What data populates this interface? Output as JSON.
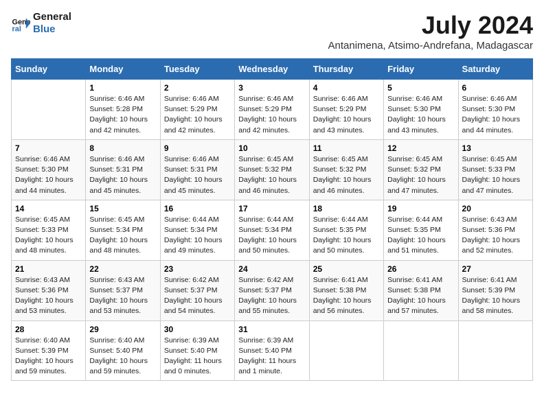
{
  "logo": {
    "line1": "General",
    "line2": "Blue"
  },
  "title": "July 2024",
  "subtitle": "Antanimena, Atsimo-Andrefana, Madagascar",
  "days_of_week": [
    "Sunday",
    "Monday",
    "Tuesday",
    "Wednesday",
    "Thursday",
    "Friday",
    "Saturday"
  ],
  "weeks": [
    [
      {
        "num": "",
        "info": ""
      },
      {
        "num": "1",
        "info": "Sunrise: 6:46 AM\nSunset: 5:28 PM\nDaylight: 10 hours\nand 42 minutes."
      },
      {
        "num": "2",
        "info": "Sunrise: 6:46 AM\nSunset: 5:29 PM\nDaylight: 10 hours\nand 42 minutes."
      },
      {
        "num": "3",
        "info": "Sunrise: 6:46 AM\nSunset: 5:29 PM\nDaylight: 10 hours\nand 42 minutes."
      },
      {
        "num": "4",
        "info": "Sunrise: 6:46 AM\nSunset: 5:29 PM\nDaylight: 10 hours\nand 43 minutes."
      },
      {
        "num": "5",
        "info": "Sunrise: 6:46 AM\nSunset: 5:30 PM\nDaylight: 10 hours\nand 43 minutes."
      },
      {
        "num": "6",
        "info": "Sunrise: 6:46 AM\nSunset: 5:30 PM\nDaylight: 10 hours\nand 44 minutes."
      }
    ],
    [
      {
        "num": "7",
        "info": "Sunrise: 6:46 AM\nSunset: 5:30 PM\nDaylight: 10 hours\nand 44 minutes."
      },
      {
        "num": "8",
        "info": "Sunrise: 6:46 AM\nSunset: 5:31 PM\nDaylight: 10 hours\nand 45 minutes."
      },
      {
        "num": "9",
        "info": "Sunrise: 6:46 AM\nSunset: 5:31 PM\nDaylight: 10 hours\nand 45 minutes."
      },
      {
        "num": "10",
        "info": "Sunrise: 6:45 AM\nSunset: 5:32 PM\nDaylight: 10 hours\nand 46 minutes."
      },
      {
        "num": "11",
        "info": "Sunrise: 6:45 AM\nSunset: 5:32 PM\nDaylight: 10 hours\nand 46 minutes."
      },
      {
        "num": "12",
        "info": "Sunrise: 6:45 AM\nSunset: 5:32 PM\nDaylight: 10 hours\nand 47 minutes."
      },
      {
        "num": "13",
        "info": "Sunrise: 6:45 AM\nSunset: 5:33 PM\nDaylight: 10 hours\nand 47 minutes."
      }
    ],
    [
      {
        "num": "14",
        "info": "Sunrise: 6:45 AM\nSunset: 5:33 PM\nDaylight: 10 hours\nand 48 minutes."
      },
      {
        "num": "15",
        "info": "Sunrise: 6:45 AM\nSunset: 5:34 PM\nDaylight: 10 hours\nand 48 minutes."
      },
      {
        "num": "16",
        "info": "Sunrise: 6:44 AM\nSunset: 5:34 PM\nDaylight: 10 hours\nand 49 minutes."
      },
      {
        "num": "17",
        "info": "Sunrise: 6:44 AM\nSunset: 5:34 PM\nDaylight: 10 hours\nand 50 minutes."
      },
      {
        "num": "18",
        "info": "Sunrise: 6:44 AM\nSunset: 5:35 PM\nDaylight: 10 hours\nand 50 minutes."
      },
      {
        "num": "19",
        "info": "Sunrise: 6:44 AM\nSunset: 5:35 PM\nDaylight: 10 hours\nand 51 minutes."
      },
      {
        "num": "20",
        "info": "Sunrise: 6:43 AM\nSunset: 5:36 PM\nDaylight: 10 hours\nand 52 minutes."
      }
    ],
    [
      {
        "num": "21",
        "info": "Sunrise: 6:43 AM\nSunset: 5:36 PM\nDaylight: 10 hours\nand 53 minutes."
      },
      {
        "num": "22",
        "info": "Sunrise: 6:43 AM\nSunset: 5:37 PM\nDaylight: 10 hours\nand 53 minutes."
      },
      {
        "num": "23",
        "info": "Sunrise: 6:42 AM\nSunset: 5:37 PM\nDaylight: 10 hours\nand 54 minutes."
      },
      {
        "num": "24",
        "info": "Sunrise: 6:42 AM\nSunset: 5:37 PM\nDaylight: 10 hours\nand 55 minutes."
      },
      {
        "num": "25",
        "info": "Sunrise: 6:41 AM\nSunset: 5:38 PM\nDaylight: 10 hours\nand 56 minutes."
      },
      {
        "num": "26",
        "info": "Sunrise: 6:41 AM\nSunset: 5:38 PM\nDaylight: 10 hours\nand 57 minutes."
      },
      {
        "num": "27",
        "info": "Sunrise: 6:41 AM\nSunset: 5:39 PM\nDaylight: 10 hours\nand 58 minutes."
      }
    ],
    [
      {
        "num": "28",
        "info": "Sunrise: 6:40 AM\nSunset: 5:39 PM\nDaylight: 10 hours\nand 59 minutes."
      },
      {
        "num": "29",
        "info": "Sunrise: 6:40 AM\nSunset: 5:40 PM\nDaylight: 10 hours\nand 59 minutes."
      },
      {
        "num": "30",
        "info": "Sunrise: 6:39 AM\nSunset: 5:40 PM\nDaylight: 11 hours\nand 0 minutes."
      },
      {
        "num": "31",
        "info": "Sunrise: 6:39 AM\nSunset: 5:40 PM\nDaylight: 11 hours\nand 1 minute."
      },
      {
        "num": "",
        "info": ""
      },
      {
        "num": "",
        "info": ""
      },
      {
        "num": "",
        "info": ""
      }
    ]
  ]
}
